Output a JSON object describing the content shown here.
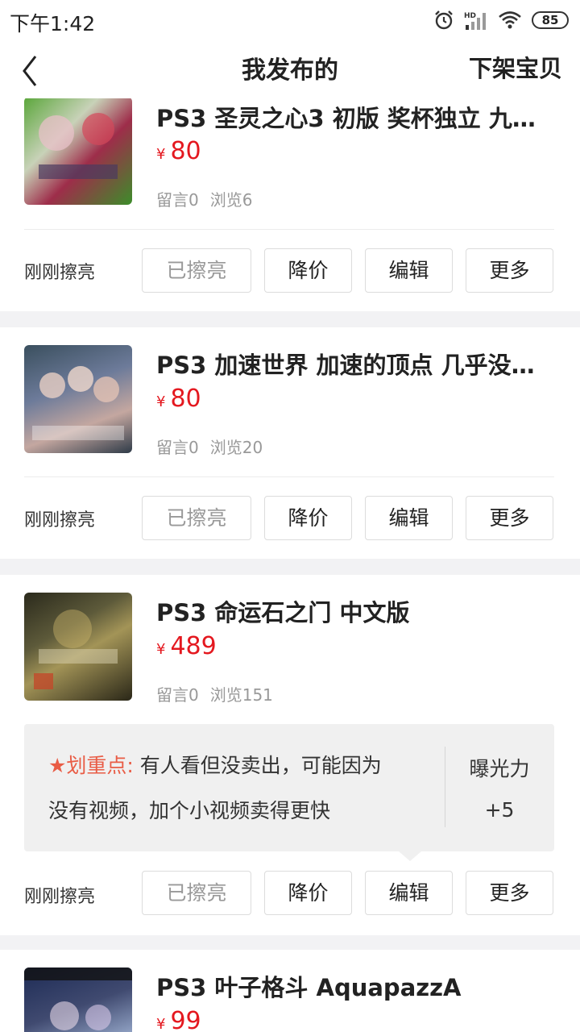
{
  "status": {
    "time": "下午1:42",
    "battery": "85",
    "signal_label": "HD"
  },
  "header": {
    "title": "我发布的",
    "action": "下架宝贝"
  },
  "items": [
    {
      "title": "PS3 圣灵之心3 初版  奖杯独立 九…",
      "currency": "¥",
      "price": "80",
      "comments": "留言0",
      "views": "浏览6",
      "state": "刚刚擦亮",
      "thumb_colors": [
        "#5aa63a",
        "#c8d2b8",
        "#9e2d4a"
      ]
    },
    {
      "title": "PS3 加速世界 加速的顶点 几乎没…",
      "currency": "¥",
      "price": "80",
      "comments": "留言0",
      "views": "浏览20",
      "state": "刚刚擦亮",
      "thumb_colors": [
        "#3a4f5e",
        "#c4a7a0",
        "#6d7b9a"
      ]
    },
    {
      "title": "PS3 命运石之门 中文版",
      "currency": "¥",
      "price": "489",
      "comments": "留言0",
      "views": "浏览151",
      "state": "刚刚擦亮",
      "thumb_colors": [
        "#2b2a1c",
        "#a39457",
        "#5d5a3a"
      ]
    },
    {
      "title": "PS3 叶子格斗 AquapazzA",
      "currency": "¥",
      "price": "99",
      "thumb_colors": [
        "#1d2b55",
        "#8d9ec0",
        "#404a70"
      ]
    }
  ],
  "buttons": {
    "polished": "已擦亮",
    "reduce_price": "降价",
    "edit": "编辑",
    "more": "更多"
  },
  "tip": {
    "highlight": "★划重点:",
    "text1": " 有人看但没卖出，可能因为",
    "text2": "没有视频，加个小视频卖得更快",
    "exposure_label": "曝光力",
    "exposure_value": "+5"
  },
  "colors": {
    "price": "#e4181f",
    "highlight": "#e95c45",
    "background": "#f2f2f4"
  }
}
